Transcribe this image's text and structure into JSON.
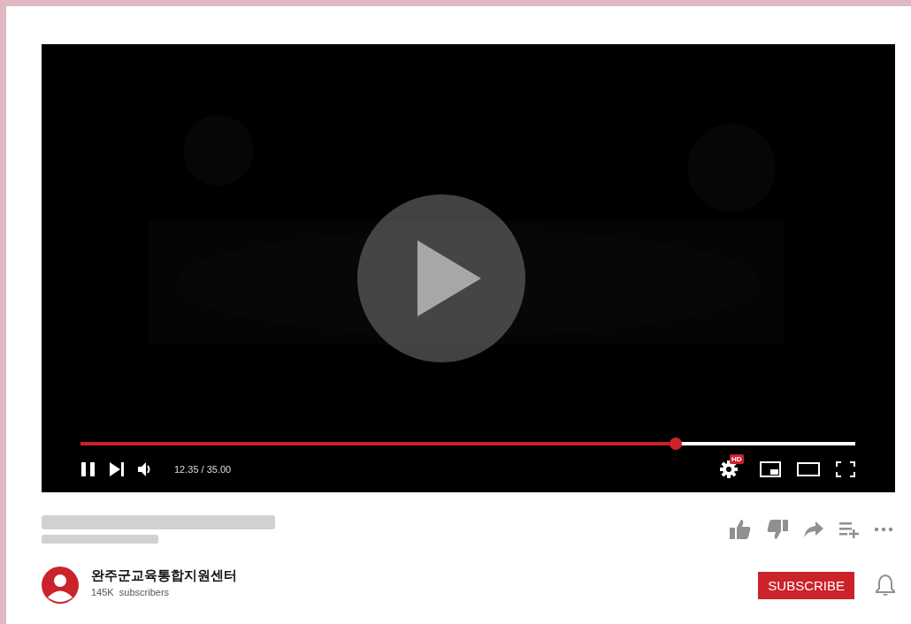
{
  "player": {
    "playing": true,
    "level": 0.768,
    "time": "12.35 / 35.00",
    "quality_badge": "HD"
  },
  "channel": {
    "name": "완주군교육통합지원센터",
    "subscribers": "145K  subscribers"
  },
  "subscribe_button": "SUBSCRIBE"
}
